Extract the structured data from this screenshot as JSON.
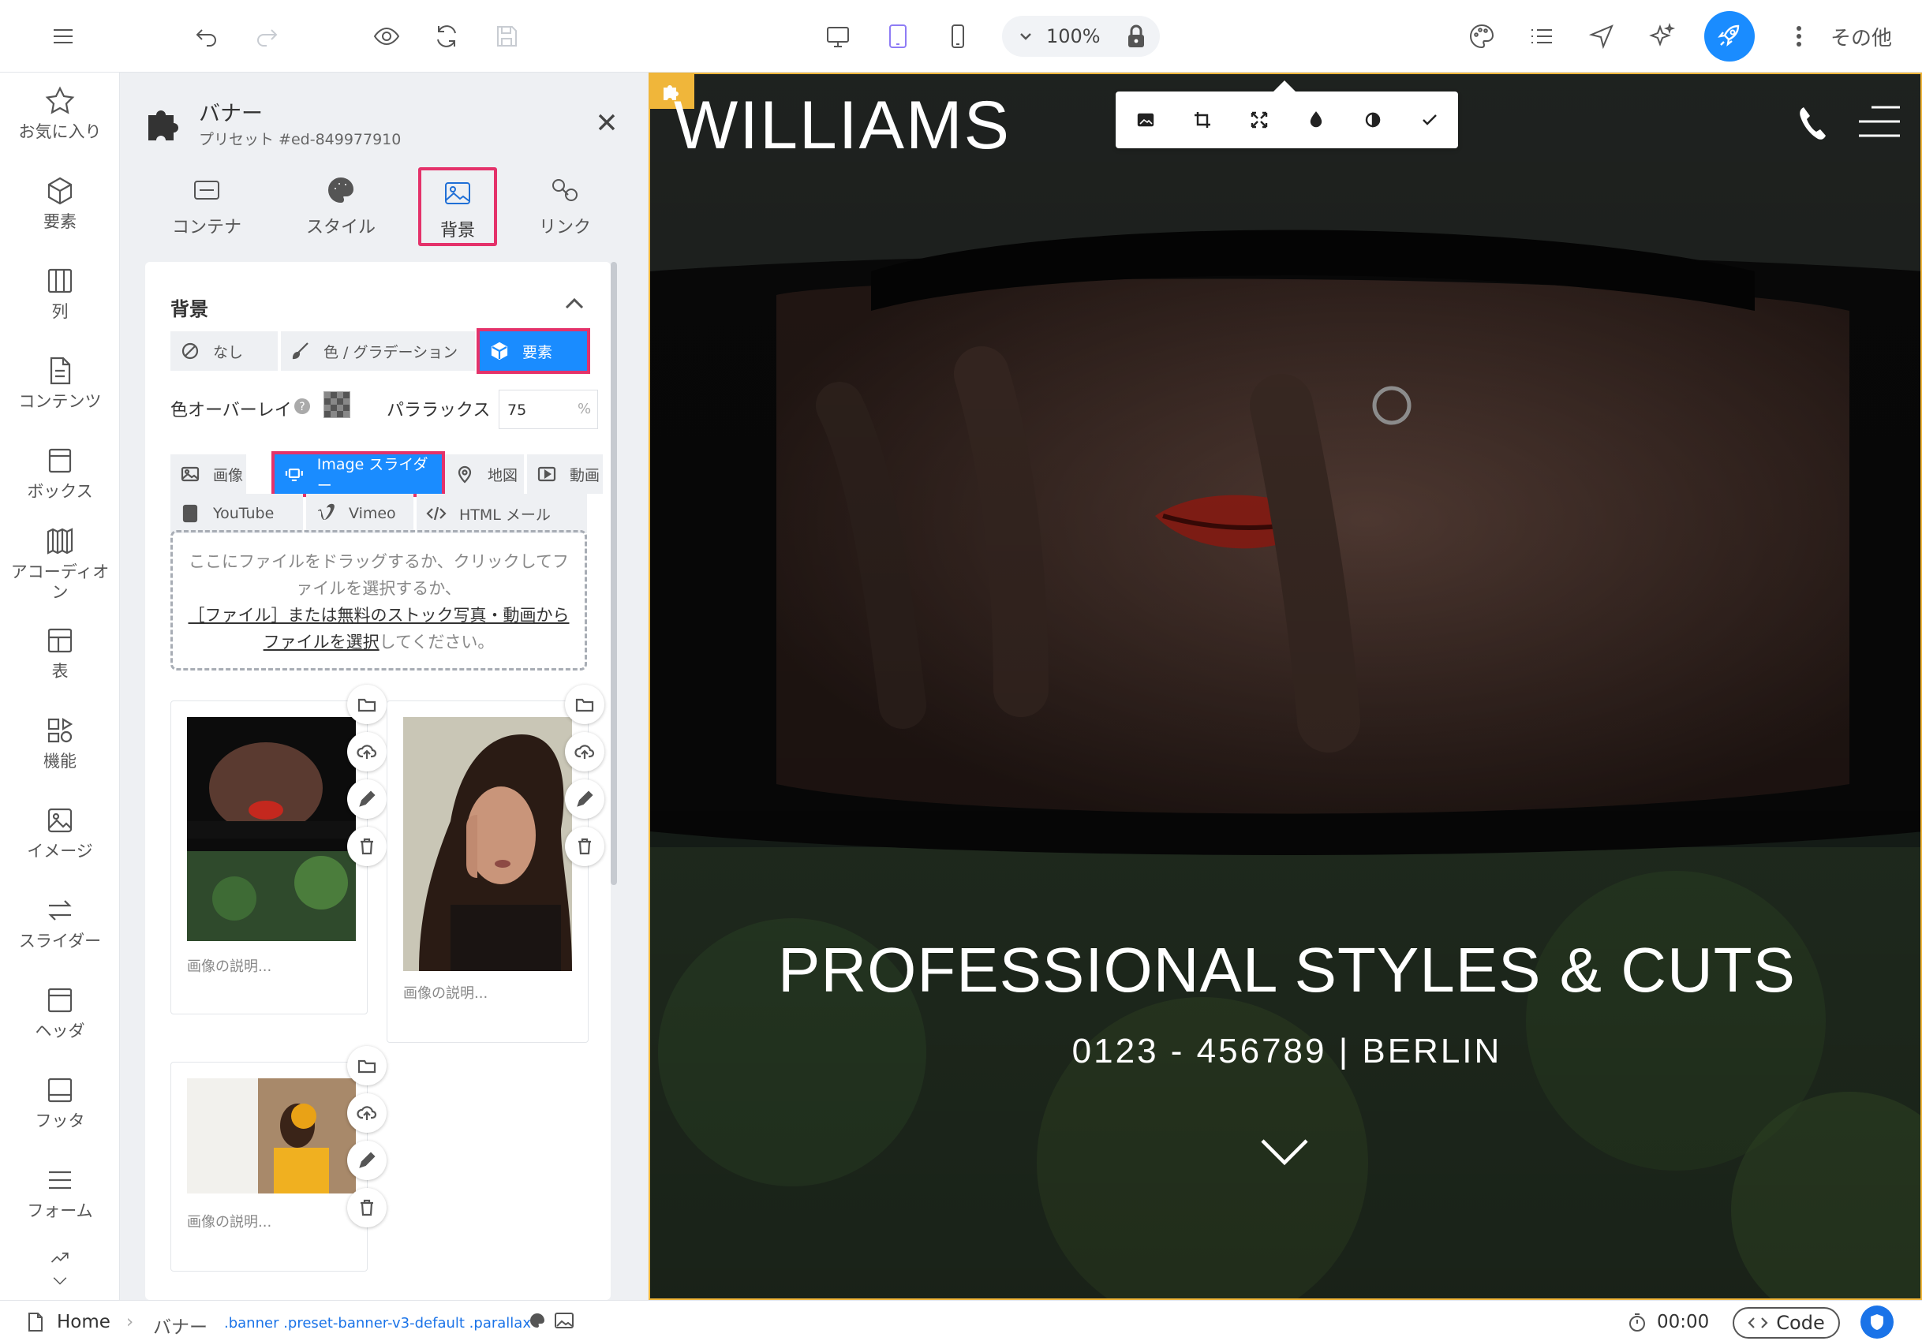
{
  "toolbar": {
    "zoom": "100%",
    "more_label": "その他"
  },
  "rail": {
    "items": [
      {
        "label": "お気に入り",
        "icon": "star-icon"
      },
      {
        "label": "要素",
        "icon": "cube-icon"
      },
      {
        "label": "列",
        "icon": "columns-icon"
      },
      {
        "label": "コンテンツ",
        "icon": "document-icon"
      },
      {
        "label": "ボックス",
        "icon": "box-icon"
      },
      {
        "label": "アコーディオン",
        "icon": "accordion-icon"
      },
      {
        "label": "表",
        "icon": "table-icon"
      },
      {
        "label": "機能",
        "icon": "feature-icon"
      },
      {
        "label": "イメージ",
        "icon": "image-icon"
      },
      {
        "label": "スライダー",
        "icon": "slider-icon"
      },
      {
        "label": "ヘッダ",
        "icon": "header-icon"
      },
      {
        "label": "フッタ",
        "icon": "footer-icon"
      },
      {
        "label": "フォーム",
        "icon": "form-icon"
      }
    ]
  },
  "panel": {
    "title": "バナー",
    "subtitle": "プリセット #ed-849977910",
    "tabs": [
      {
        "label": "コンテナ",
        "icon": "container-icon"
      },
      {
        "label": "スタイル",
        "icon": "palette-icon"
      },
      {
        "label": "背景",
        "icon": "image-icon",
        "active": true
      },
      {
        "label": "リンク",
        "icon": "link-icon"
      }
    ],
    "section_title": "背景",
    "bg_modes": [
      "なし",
      "色 / グラデーション",
      "要素"
    ],
    "overlay_label": "色オーバーレイ",
    "parallax_label": "パララックス",
    "parallax_value": "75",
    "parallax_unit": "%",
    "element_types": [
      "画像",
      "Image スライダー",
      "地図",
      "動画",
      "YouTube",
      "Vimeo",
      "HTML メール"
    ],
    "dropzone_text": "ここにファイルをドラッグするか、クリックしてファイルを選択するか、",
    "dropzone_link": "［ファイル］または無料のストック写真・動画からファイルを選択",
    "dropzone_suffix": "してください。",
    "image_caption_placeholder": "画像の説明..."
  },
  "preview": {
    "logo": "WILLIAMS",
    "hero_title": "PROFESSIONAL STYLES & CUTS",
    "hero_subtitle": "0123 - 456789 | BERLIN"
  },
  "statusbar": {
    "home": "Home",
    "crumb": "バナー",
    "classes": ".banner .preset-banner-v3-default .parallax",
    "timer": "00:00",
    "code_label": "Code"
  },
  "colors": {
    "accent": "#1a8cff",
    "highlight": "#e4326a",
    "section_outline": "#f0b63a",
    "active_device": "#8e7cf5"
  }
}
